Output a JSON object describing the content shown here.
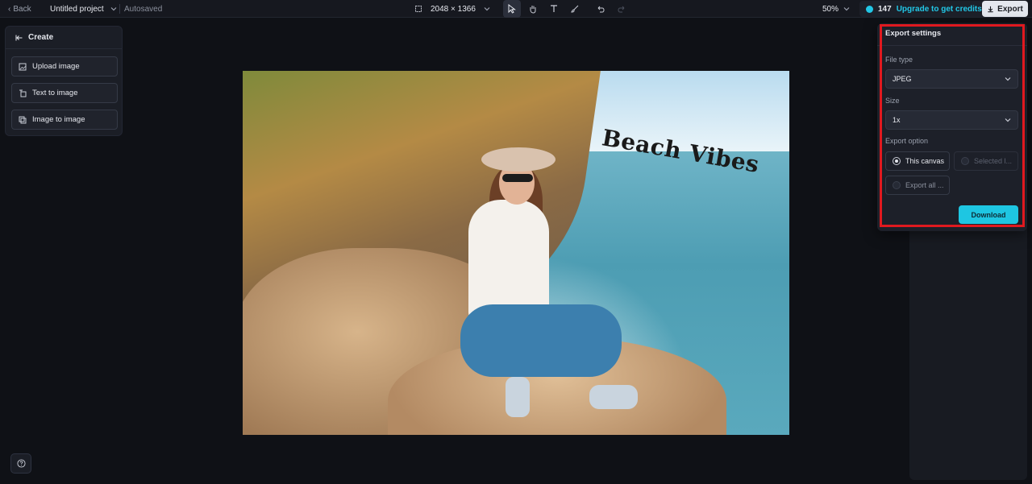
{
  "topbar": {
    "back_label": "Back",
    "project_name": "Untitled project",
    "save_status": "Autosaved",
    "canvas_size": "2048 × 1366",
    "zoom": "50%",
    "credits": "147",
    "upgrade_label": "Upgrade to get credits",
    "export_label": "Export"
  },
  "sidebar": {
    "header": "Create",
    "items": [
      {
        "label": "Upload image",
        "icon": "upload-image-icon"
      },
      {
        "label": "Text to image",
        "icon": "text-image-icon"
      },
      {
        "label": "Image to image",
        "icon": "image-image-icon"
      }
    ]
  },
  "canvas": {
    "overlay_text": "Beach Vibes"
  },
  "export_settings": {
    "title": "Export settings",
    "file_type_label": "File type",
    "file_type_value": "JPEG",
    "size_label": "Size",
    "size_value": "1x",
    "export_option_label": "Export option",
    "options": [
      {
        "label": "This canvas",
        "selected": true,
        "enabled": true
      },
      {
        "label": "Selected l...",
        "selected": false,
        "enabled": false
      },
      {
        "label": "Export all ...",
        "selected": false,
        "enabled": true
      }
    ],
    "download_label": "Download"
  },
  "colors": {
    "accent": "#1ec6e2",
    "highlight": "#e0191f",
    "background": "#0f1116"
  }
}
